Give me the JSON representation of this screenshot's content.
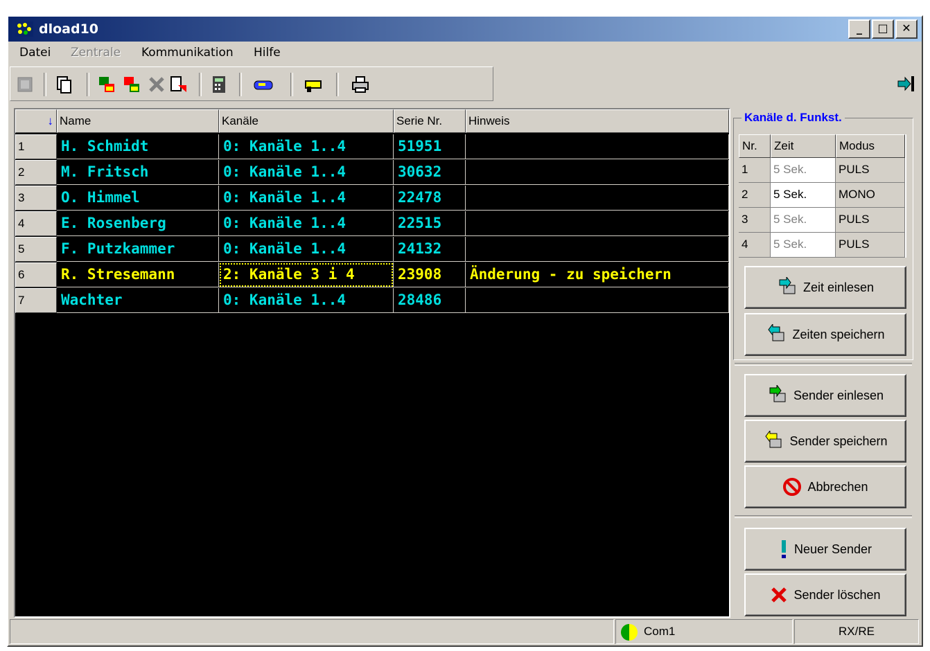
{
  "window": {
    "title": "dload10"
  },
  "menu": [
    "Datei",
    "Zentrale",
    "Kommunikation",
    "Hilfe"
  ],
  "icons": [
    "app-icon",
    "minimize-icon",
    "maximize-icon",
    "close-icon",
    "chip-icon",
    "copy-icon",
    "read-icon",
    "write-icon",
    "delete-icon",
    "export-icon",
    "calculator-icon",
    "remote-icon",
    "gun-icon",
    "printer-icon",
    "exit-icon"
  ],
  "grid": {
    "sort_indicator": "↓",
    "headers": [
      "Name",
      "Kanäle",
      "Serie Nr.",
      "Hinweis"
    ],
    "rows": [
      {
        "nr": "1",
        "name": "H. Schmidt",
        "kanale": "0: Kanäle 1..4",
        "serie": "51951",
        "hinweis": ""
      },
      {
        "nr": "2",
        "name": "M. Fritsch",
        "kanale": "0: Kanäle 1..4",
        "serie": "30632",
        "hinweis": ""
      },
      {
        "nr": "3",
        "name": "O. Himmel",
        "kanale": "0: Kanäle 1..4",
        "serie": "22478",
        "hinweis": ""
      },
      {
        "nr": "4",
        "name": "E. Rosenberg",
        "kanale": "0: Kanäle 1..4",
        "serie": "22515",
        "hinweis": ""
      },
      {
        "nr": "5",
        "name": "F. Putzkammer",
        "kanale": "0: Kanäle 1..4",
        "serie": "24132",
        "hinweis": ""
      },
      {
        "nr": "6",
        "name": "R. Stresemann",
        "kanale": "2: Kanäle 3 i 4",
        "serie": "23908",
        "hinweis": "Änderung - zu speichern"
      },
      {
        "nr": "7",
        "name": "Wachter",
        "kanale": "0: Kanäle 1..4",
        "serie": "28486",
        "hinweis": ""
      }
    ]
  },
  "channels": {
    "title": "Kanäle d. Funkst.",
    "headers": [
      "Nr.",
      "Zeit",
      "Modus"
    ],
    "rows": [
      {
        "nr": "1",
        "zeit": "5 Sek.",
        "modus": "PULS"
      },
      {
        "nr": "2",
        "zeit": "5 Sek.",
        "modus": "MONO"
      },
      {
        "nr": "3",
        "zeit": "5 Sek.",
        "modus": "PULS"
      },
      {
        "nr": "4",
        "zeit": "5 Sek.",
        "modus": "PULS"
      }
    ]
  },
  "buttons": {
    "zeit_einlesen": "Zeit einlesen",
    "zeiten_speichern": "Zeiten speichern",
    "sender_einlesen": "Sender einlesen",
    "sender_speichern": "Sender speichern",
    "abbrechen": "Abbrechen",
    "neuer_sender": "Neuer Sender",
    "sender_loeschen": "Sender löschen"
  },
  "status": {
    "port": "Com1",
    "mode": "RX/RE"
  }
}
